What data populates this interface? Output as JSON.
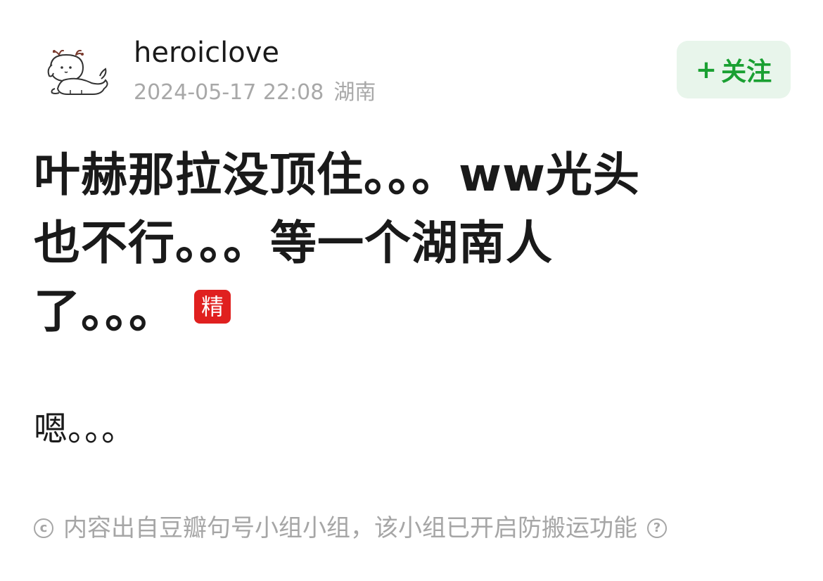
{
  "author": {
    "name": "heroiclove",
    "timestamp": "2024-05-17 22:08",
    "location": "湖南",
    "avatar_icon": "cartoon-dog-avatar"
  },
  "follow_button": {
    "plus": "+",
    "label": "关注",
    "color": "#1aa032",
    "background": "#e8f5eb"
  },
  "post": {
    "title_lines": [
      "叶赫那拉没顶住。。。ww光头",
      "也不行。。。等一个湖南人",
      "了。。。"
    ],
    "featured_badge": "精",
    "badge_color": "#e0201f",
    "body": "嗯。。。"
  },
  "notice": {
    "copyright_glyph": "c",
    "text": "内容出自豆瓣句号小组小组，该小组已开启防搬运功能",
    "help_glyph": "?"
  }
}
